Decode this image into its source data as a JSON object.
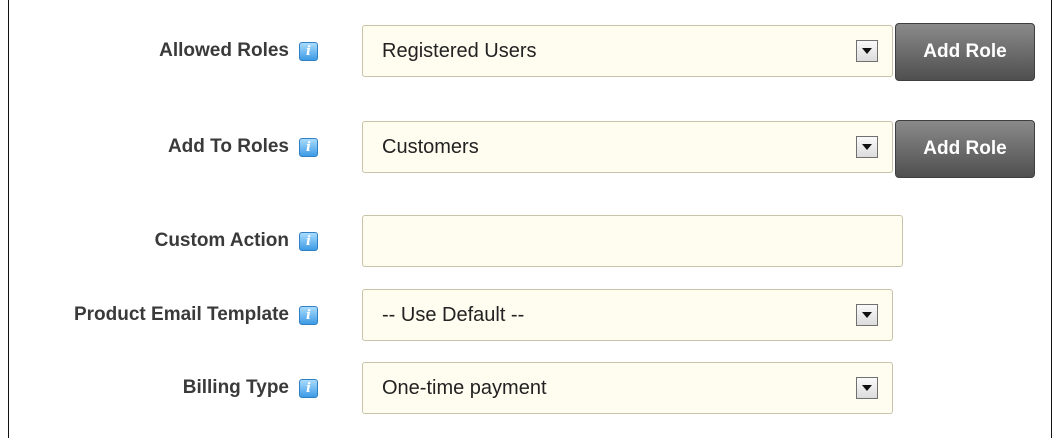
{
  "form": {
    "allowed_roles": {
      "label": "Allowed Roles",
      "selected": "Registered Users",
      "button": "Add Role"
    },
    "add_to_roles": {
      "label": "Add To Roles",
      "selected": "Customers",
      "button": "Add Role"
    },
    "custom_action": {
      "label": "Custom Action",
      "value": ""
    },
    "product_email_template": {
      "label": "Product Email Template",
      "selected": "-- Use Default --"
    },
    "billing_type": {
      "label": "Billing Type",
      "selected": "One-time payment"
    }
  },
  "icons": {
    "help": "help-icon",
    "dropdown": "chevron-down-icon"
  },
  "colors": {
    "field_background": "#fffdf0",
    "field_border": "#c9c3a8",
    "button_background": "#6b6b6b",
    "help_icon": "#3d9be5",
    "label_text": "#3a3a3a"
  }
}
